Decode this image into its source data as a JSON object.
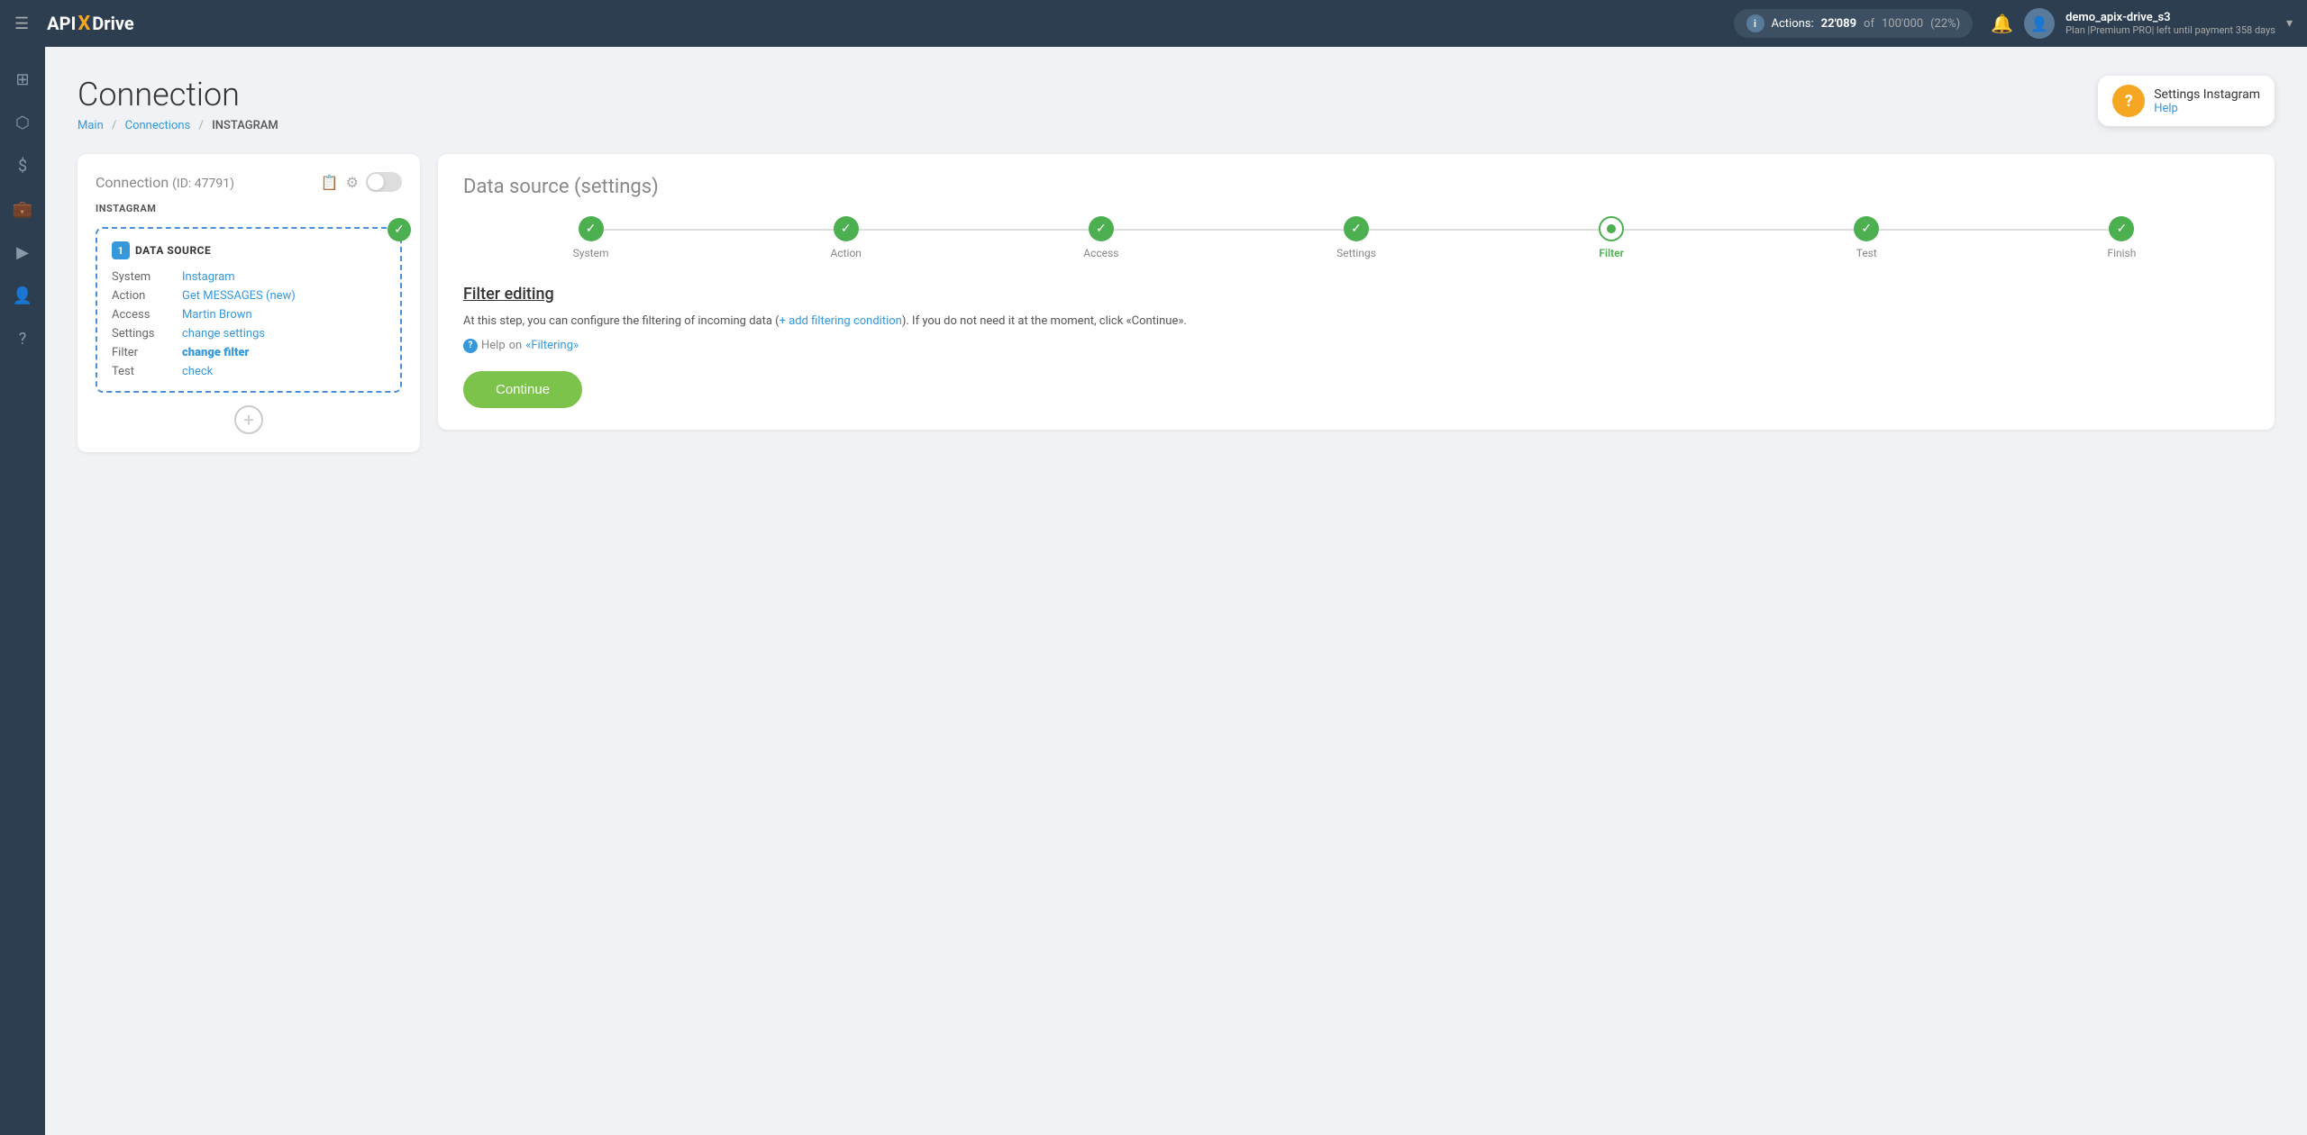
{
  "topnav": {
    "menu_icon": "☰",
    "logo_api": "API",
    "logo_x": "X",
    "logo_drive": "Drive",
    "actions_label": "Actions:",
    "actions_count": "22'089",
    "actions_of": "of",
    "actions_total": "100'000",
    "actions_pct": "(22%)",
    "bell_icon": "🔔",
    "user_avatar_icon": "👤",
    "user_name": "demo_apix-drive_s3",
    "user_plan": "Plan |Premium PRO| left until payment 358 days",
    "chevron_icon": "▾"
  },
  "sidebar": {
    "items": [
      {
        "icon": "⊞",
        "name": "dashboard"
      },
      {
        "icon": "⬡",
        "name": "connections"
      },
      {
        "icon": "$",
        "name": "billing"
      },
      {
        "icon": "💼",
        "name": "briefcase"
      },
      {
        "icon": "▶",
        "name": "media"
      },
      {
        "icon": "👤",
        "name": "profile"
      },
      {
        "icon": "?",
        "name": "help"
      }
    ]
  },
  "breadcrumb": {
    "main": "Main",
    "connections": "Connections",
    "current": "INSTAGRAM",
    "sep": "/"
  },
  "page_title": "Connection",
  "help_bubble": {
    "icon": "?",
    "title": "Settings Instagram",
    "link": "Help"
  },
  "left_card": {
    "title": "Connection",
    "title_id": "(ID: 47791)",
    "copy_icon": "📋",
    "settings_icon": "⚙",
    "toggle_state": "off",
    "source_label": "INSTAGRAM",
    "ds_number": "1",
    "ds_title": "DATA SOURCE",
    "rows": [
      {
        "label": "System",
        "value": "Instagram",
        "bold": false
      },
      {
        "label": "Action",
        "value": "Get MESSAGES (new)",
        "bold": false
      },
      {
        "label": "Access",
        "value": "Martin Brown",
        "bold": false
      },
      {
        "label": "Settings",
        "value": "change settings",
        "bold": false
      },
      {
        "label": "Filter",
        "value": "change filter",
        "bold": true
      },
      {
        "label": "Test",
        "value": "check",
        "bold": false
      }
    ],
    "add_btn": "+"
  },
  "right_card": {
    "title": "Data source",
    "title_paren": "(settings)",
    "steps": [
      {
        "label": "System",
        "state": "done"
      },
      {
        "label": "Action",
        "state": "done"
      },
      {
        "label": "Access",
        "state": "done"
      },
      {
        "label": "Settings",
        "state": "done"
      },
      {
        "label": "Filter",
        "state": "active"
      },
      {
        "label": "Test",
        "state": "done"
      },
      {
        "label": "Finish",
        "state": "done"
      }
    ],
    "filter_heading": "Filter editing",
    "filter_desc_pre": "At this step, you can configure the filtering of incoming data (",
    "filter_desc_link": "+ add filtering condition",
    "filter_desc_post": "). If you do not need it at the moment, click «Continue».",
    "filter_help_pre": "Help",
    "filter_help_on": "on",
    "filter_help_link": "«Filtering»",
    "continue_btn": "Continue"
  }
}
